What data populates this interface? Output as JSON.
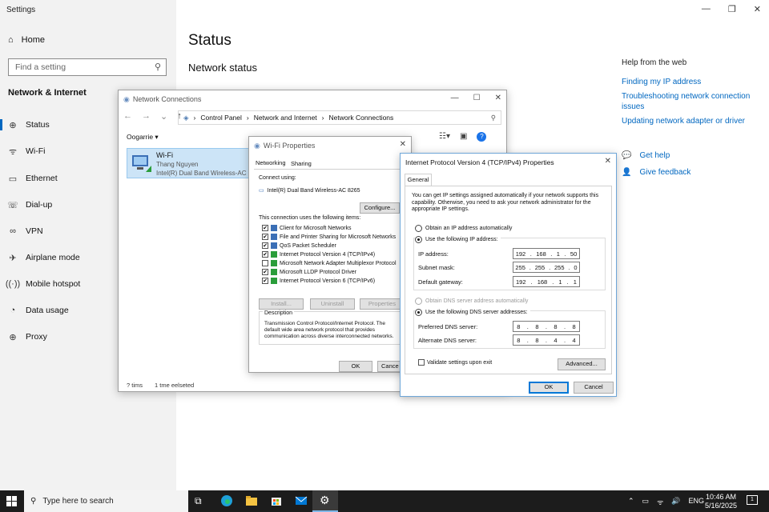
{
  "settings": {
    "app_title": "Settings",
    "home": "Home",
    "search_placeholder": "Find a setting",
    "section": "Network & Internet",
    "nav": [
      "Status",
      "Wi-Fi",
      "Ethernet",
      "Dial-up",
      "VPN",
      "Airplane mode",
      "Mobile hotspot",
      "Data usage",
      "Proxy"
    ],
    "page_title": "Status",
    "page_subtitle": "Network status",
    "help_head": "Help from the web",
    "links": [
      "Finding my IP address",
      "Troubleshooting network connection issues",
      "Updating network adapter or driver"
    ],
    "get_help": "Get help",
    "give_feedback": "Give feedback"
  },
  "netconn": {
    "title": "Network Connections",
    "breadcrumb": [
      "Control Panel",
      "Network and Internet",
      "Network Connections"
    ],
    "organize": "Oogarrie ▾",
    "adapter": {
      "name": "Wi-Fi",
      "user": "Thang Nguyen",
      "device": "Intel(R) Dual Band Wireless-AC 82"
    },
    "status_items": "? tims",
    "status_selected": "1 tme eelseted"
  },
  "wifiprops": {
    "title": "Wi-Fi Properties",
    "tabs": [
      "Networking",
      "Sharing"
    ],
    "connect_using_label": "Connect using:",
    "adapter": "Intel(R) Dual Band Wireless-AC 8265",
    "configure": "Configure...",
    "items_label": "This connection uses the following items:",
    "items": [
      {
        "label": "Client for Microsoft Networks",
        "checked": true
      },
      {
        "label": "File and Printer Sharing for Microsoft Networks",
        "checked": true
      },
      {
        "label": "QoS Packet Scheduler",
        "checked": true
      },
      {
        "label": "Internet Protocol Version 4 (TCP/IPv4)",
        "checked": true
      },
      {
        "label": "Microsoft Network Adapter Multiplexor Protocol",
        "checked": false
      },
      {
        "label": "Microsoft LLDP Protocol Driver",
        "checked": true
      },
      {
        "label": "Internet Protocol Version 6 (TCP/IPv6)",
        "checked": true
      }
    ],
    "install": "Install...",
    "uninstall": "Uninstall",
    "properties": "Properties",
    "desc_label": "Description",
    "desc_text": "Transmission Control Protocol/Internet Protocol. The default wide area network protocol that provides communication across diverse interconnected networks.",
    "ok": "OK",
    "cancel": "Cance"
  },
  "ipv4": {
    "title": "Internet Protocol Version 4 (TCP/IPv4) Properties",
    "tab": "General",
    "intro": "You can get IP settings assigned automatically if your network supports this capability. Otherwise, you need to ask your network administrator for the appropriate IP settings.",
    "auto_ip": "Obtain an IP address automatically",
    "use_ip": "Use the following IP address:",
    "ip_label": "IP address:",
    "ip": [
      "192",
      "168",
      "1",
      "50"
    ],
    "mask_label": "Subnet mask:",
    "mask": [
      "255",
      "255",
      "255",
      "0"
    ],
    "gw_label": "Default gateway:",
    "gw": [
      "192",
      "168",
      "1",
      "1"
    ],
    "auto_dns": "Obtain DNS server address automatically",
    "use_dns": "Use the following DNS server addresses:",
    "pdns_label": "Preferred DNS server:",
    "pdns": [
      "8",
      "8",
      "8",
      "8"
    ],
    "adns_label": "Alternate DNS server:",
    "adns": [
      "8",
      "8",
      "4",
      "4"
    ],
    "validate": "Validate settings upon exit",
    "advanced": "Advanced...",
    "ok": "OK",
    "cancel": "Cancel"
  },
  "taskbar": {
    "search": "Type here to search",
    "lang": "ENG",
    "time": "10:46 AM",
    "date": "5/16/2025",
    "notif_count": "1"
  }
}
